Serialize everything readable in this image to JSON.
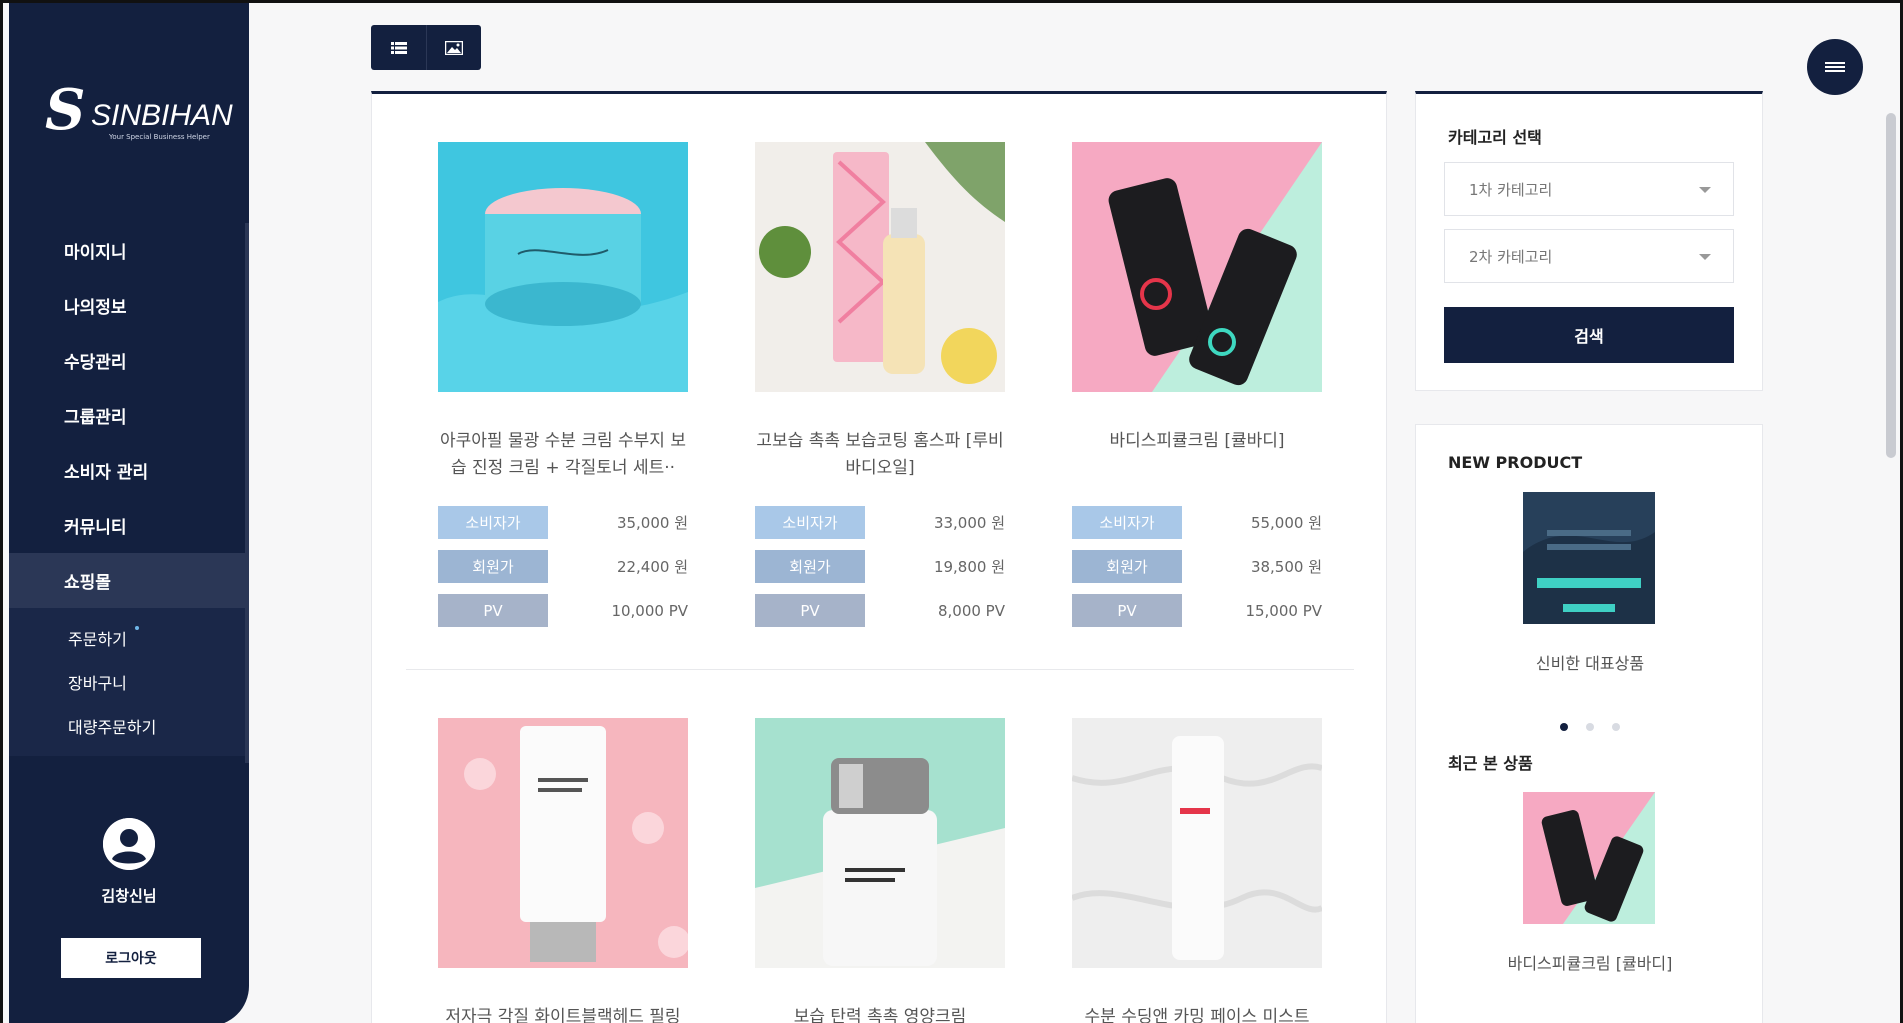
{
  "brand": {
    "mark": "S",
    "name": "SINBIHAN",
    "tagline": "Your Special Business Helper"
  },
  "sidebar": {
    "items": [
      {
        "label": "마이지니"
      },
      {
        "label": "나의정보"
      },
      {
        "label": "수당관리"
      },
      {
        "label": "그룹관리"
      },
      {
        "label": "소비자 관리"
      },
      {
        "label": "커뮤니티"
      },
      {
        "label": "쇼핑몰"
      }
    ],
    "sub_items": [
      {
        "label": "주문하기"
      },
      {
        "label": "장바구니"
      },
      {
        "label": "대량주문하기"
      }
    ],
    "user_name": "김창신님",
    "logout_label": "로그아웃"
  },
  "price_labels": {
    "consumer": "소비자가",
    "member": "회원가",
    "pv": "PV"
  },
  "products": [
    {
      "name": "아쿠아필 물광 수분 크림 수부지 보습 진정 크림 + 각질토너 세트··",
      "consumer_price": "35,000 원",
      "member_price": "22,400 원",
      "pv": "10,000 PV"
    },
    {
      "name": "고보습 촉촉 보습코팅 홈스파 [루비바디오일]",
      "consumer_price": "33,000 원",
      "member_price": "19,800 원",
      "pv": "8,000 PV"
    },
    {
      "name": "바디스피큘크림 [큘바디]",
      "consumer_price": "55,000 원",
      "member_price": "38,500 원",
      "pv": "15,000 PV"
    },
    {
      "name": "저자극 각질 화이트블랙헤드 필링"
    },
    {
      "name": "보습 탄력 촉촉 영양크림"
    },
    {
      "name": "수분 수딩앤 카밍 페이스 미스트"
    }
  ],
  "category": {
    "title": "카테고리 선택",
    "first_placeholder": "1차 카테고리",
    "second_placeholder": "2차 카테고리",
    "search_label": "검색"
  },
  "new_product": {
    "title": "NEW PRODUCT",
    "name": "신비한 대표상품"
  },
  "recent": {
    "title": "최근 본 상품",
    "name": "바디스피큘크림 [큘바디]"
  },
  "colors": {
    "navy": "#13203f",
    "consumer_badge": "#a9c8e8",
    "member_badge": "#9cb5d3",
    "pv_badge": "#a6b3c9"
  }
}
